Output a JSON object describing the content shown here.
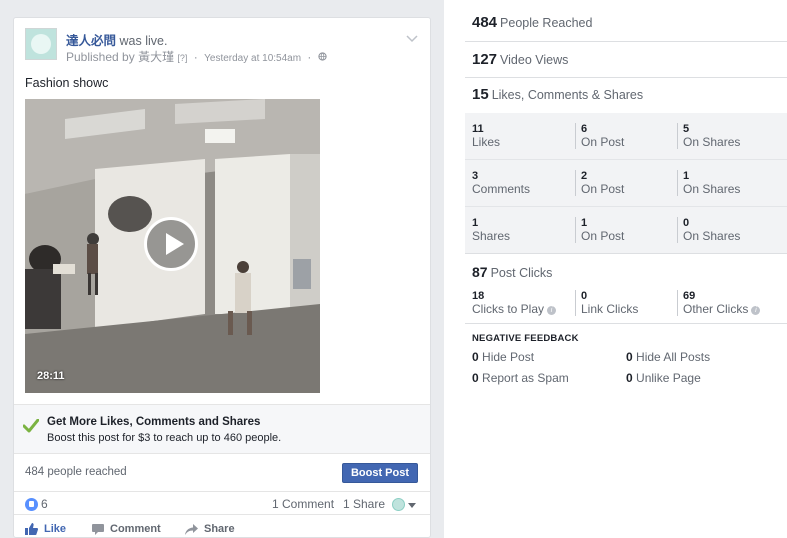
{
  "post": {
    "author": "達人必問",
    "action": "was live.",
    "published_by_prefix": "Published by",
    "publisher": "黃大瑾",
    "publisher_tag": "[?]",
    "separator": "·",
    "time": "Yesterday at 10:54am",
    "text": "Fashion showc",
    "video_duration": "28:11",
    "promo_title": "Get More Likes, Comments and Shares",
    "promo_subtitle": "Boost this post for $3 to reach up to 460 people.",
    "reached": "484 people reached",
    "boost_button": "Boost Post",
    "like_count": "6",
    "comments": "1 Comment",
    "shares": "1 Share",
    "actions": {
      "like": "Like",
      "comment": "Comment",
      "share": "Share"
    },
    "colors": {
      "link": "#365899",
      "button": "#4267b2",
      "check": "#7bb342"
    }
  },
  "stats": {
    "reached": {
      "value": "484",
      "label": "People Reached"
    },
    "video_views": {
      "value": "127",
      "label": "Video Views"
    },
    "engagement": {
      "value": "15",
      "label": "Likes, Comments & Shares"
    },
    "grid": [
      [
        {
          "value": "11",
          "label": "Likes"
        },
        {
          "value": "6",
          "label": "On Post"
        },
        {
          "value": "5",
          "label": "On Shares"
        }
      ],
      [
        {
          "value": "3",
          "label": "Comments"
        },
        {
          "value": "2",
          "label": "On Post"
        },
        {
          "value": "1",
          "label": "On Shares"
        }
      ],
      [
        {
          "value": "1",
          "label": "Shares"
        },
        {
          "value": "1",
          "label": "On Post"
        },
        {
          "value": "0",
          "label": "On Shares"
        }
      ]
    ],
    "post_clicks": {
      "value": "87",
      "label": "Post Clicks"
    },
    "clicks": [
      {
        "value": "18",
        "label": "Clicks to Play"
      },
      {
        "value": "0",
        "label": "Link Clicks"
      },
      {
        "value": "69",
        "label": "Other Clicks"
      }
    ],
    "negative_title": "NEGATIVE FEEDBACK",
    "negative": [
      {
        "value": "0",
        "label": "Hide Post"
      },
      {
        "value": "0",
        "label": "Hide All Posts"
      },
      {
        "value": "0",
        "label": "Report as Spam"
      },
      {
        "value": "0",
        "label": "Unlike Page"
      }
    ]
  }
}
